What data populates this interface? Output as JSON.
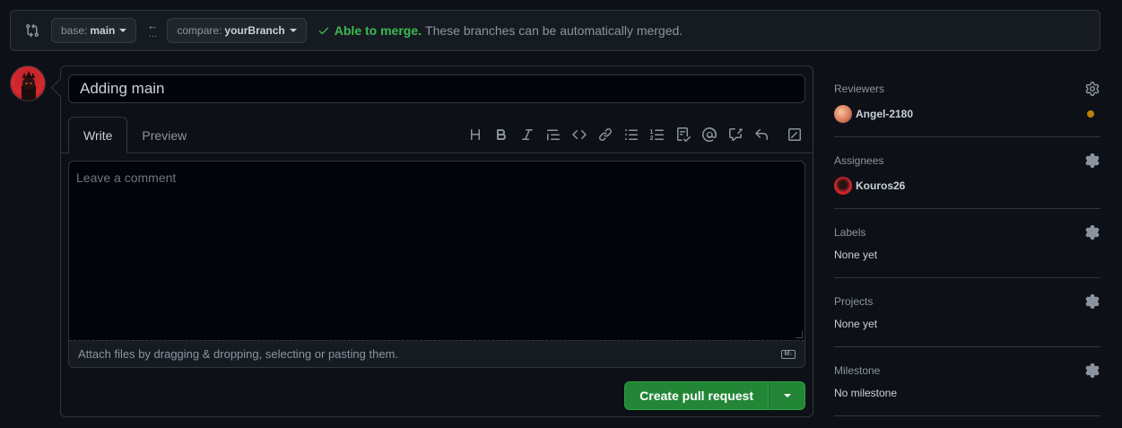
{
  "range": {
    "base_prefix": "base:",
    "base_branch": "main",
    "compare_prefix": "compare:",
    "compare_branch": "yourBranch",
    "status_title": "Able to merge.",
    "status_desc": "These branches can be automatically merged.",
    "status_color": "#3fb950"
  },
  "composer": {
    "title_value": "Adding main",
    "tabs": [
      "Write",
      "Preview"
    ],
    "comment_placeholder": "Leave a comment",
    "attach_text": "Attach files by dragging & dropping, selecting or pasting them.",
    "toolbar_icons": [
      "heading-icon",
      "bold-icon",
      "italic-icon",
      "quote-icon",
      "code-icon",
      "link-icon",
      "unordered-list-icon",
      "ordered-list-icon",
      "task-list-icon",
      "mention-icon",
      "cross-reference-icon",
      "reply-icon",
      "fullscreen-icon"
    ],
    "create_label": "Create pull request",
    "accent_color": "#238636"
  },
  "sidebar": {
    "reviewers": {
      "label": "Reviewers",
      "user": "Angel-2180",
      "pending_color": "#bb8009"
    },
    "assignees": {
      "label": "Assignees",
      "user": "Kouros26"
    },
    "labels": {
      "label": "Labels",
      "value": "None yet"
    },
    "projects": {
      "label": "Projects",
      "value": "None yet"
    },
    "milestone": {
      "label": "Milestone",
      "value": "No milestone"
    }
  }
}
